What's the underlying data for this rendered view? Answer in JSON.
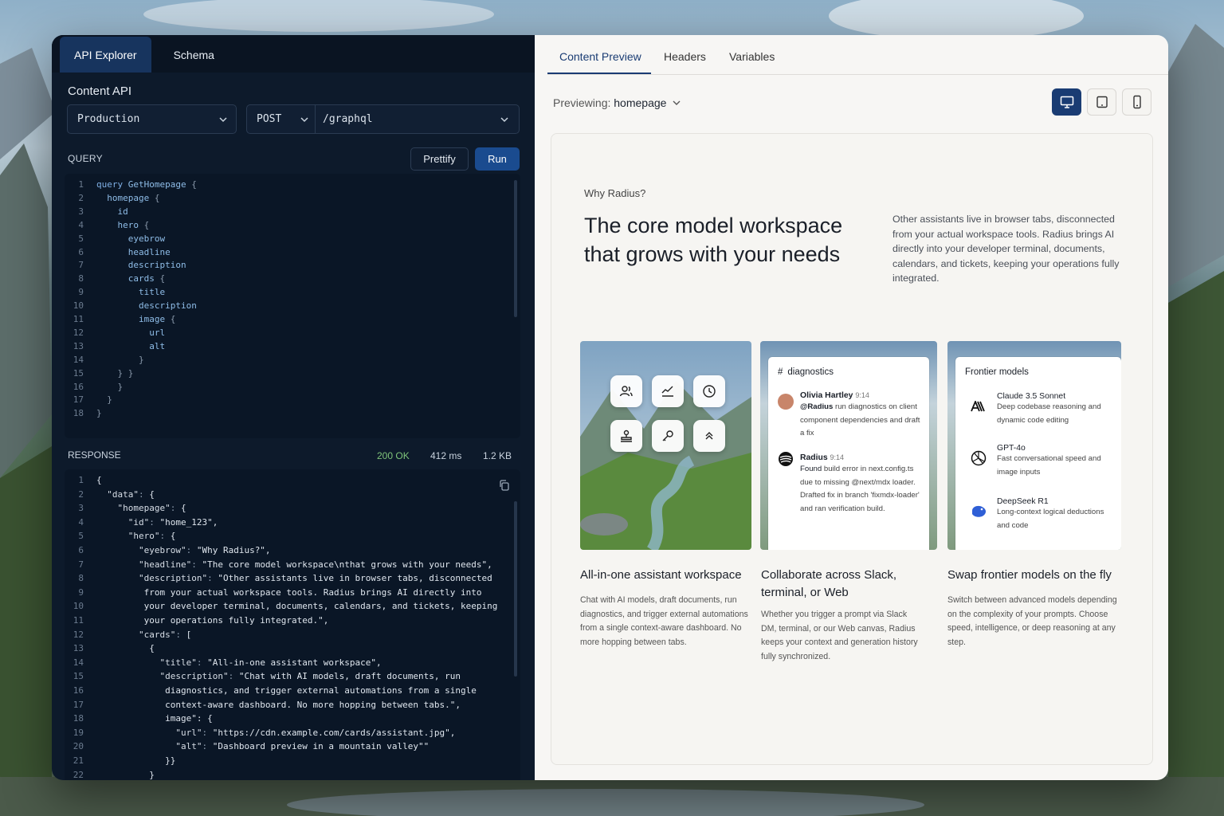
{
  "left": {
    "tabs": [
      "API Explorer",
      "Schema"
    ],
    "section_title": "Content API",
    "environment": "Production",
    "method": "POST",
    "endpoint": "/graphql",
    "query_label": "QUERY",
    "prettify_label": "Prettify",
    "run_label": "Run",
    "response_label": "RESPONSE",
    "status": "200 OK",
    "time": "412 ms",
    "size": "1.2 KB",
    "query_lines": [
      "query GetHomepage {",
      "  homepage {",
      "    id",
      "    hero {",
      "      eyebrow",
      "      headline",
      "      description",
      "      cards {",
      "        title",
      "        description",
      "        image {",
      "          url",
      "          alt",
      "        }",
      "    } }",
      "    }",
      "  }",
      "}"
    ],
    "response_lines": [
      "{",
      "  \"data\": {",
      "    \"homepage\": {",
      "      \"id\": \"home_123\",",
      "      \"hero\": {",
      "        \"eyebrow\": \"Why Radius?\",",
      "        \"headline\": \"The core model workspace\\nthat grows with your needs\",",
      "        \"description\": \"Other assistants live in browser tabs, disconnected",
      "         from your actual workspace tools. Radius brings AI directly into",
      "         your developer terminal, documents, calendars, and tickets, keeping",
      "         your operations fully integrated.\",",
      "        \"cards\": [",
      "          {",
      "            \"title\": \"All-in-one assistant workspace\",",
      "            \"description\": \"Chat with AI models, draft documents, run",
      "             diagnostics, and trigger external automations from a single",
      "             context-aware dashboard. No more hopping between tabs.\",",
      "             image\": {",
      "               \"url\": \"https://cdn.example.com/cards/assistant.jpg\",",
      "               \"alt\": \"Dashboard preview in a mountain valley\"\"",
      "             }}",
      "          }"
    ]
  },
  "right": {
    "tabs": [
      "Content Preview",
      "Headers",
      "Variables"
    ],
    "previewing_label": "Previewing:",
    "previewing_value": "homepage",
    "eyebrow": "Why Radius?",
    "headline": "The core model workspace that grows with your needs",
    "description": "Other assistants live in browser tabs, disconnected from your actual workspace tools. Radius brings AI directly into your developer terminal, documents, calendars, and tickets, keeping your operations fully integrated.",
    "cards": [
      {
        "title": "All-in-one assistant workspace",
        "description": "Chat with AI models, draft documents, run diagnostics, and trigger external automations from a single context-aware dashboard. No more hopping between tabs."
      },
      {
        "title": "Collaborate across Slack, terminal, or Web",
        "description": "Whether you trigger a prompt via Slack DM, terminal, or our Web canvas, Radius keeps your context and generation history fully synchronized."
      },
      {
        "title": "Swap frontier models on the fly",
        "description": "Switch between advanced models depending on the complexity of your prompts. Choose speed, intelligence, or deep reasoning at any step."
      }
    ],
    "diagnostics": {
      "channel": "diagnostics",
      "msg1_name": "Olivia Hartley",
      "msg1_time": "9:14",
      "msg1_mention": "@Radius",
      "msg1_text": " run diagnostics on client component dependencies and draft a fix",
      "msg2_name": "Radius",
      "msg2_time": "9:14",
      "msg2_bold": "Found",
      "msg2_text": " build error in next.config.ts due to missing @next/mdx loader. Drafted fix in branch 'fixmdx-loader' and ran verification build."
    },
    "models": {
      "title": "Frontier models",
      "items": [
        {
          "name": "Claude 3.5 Sonnet",
          "desc": "Deep codebase reasoning and dynamic code editing"
        },
        {
          "name": "GPT-4o",
          "desc": "Fast conversational speed and image inputs"
        },
        {
          "name": "DeepSeek R1",
          "desc": "Long-context logical deductions and code"
        }
      ]
    }
  }
}
